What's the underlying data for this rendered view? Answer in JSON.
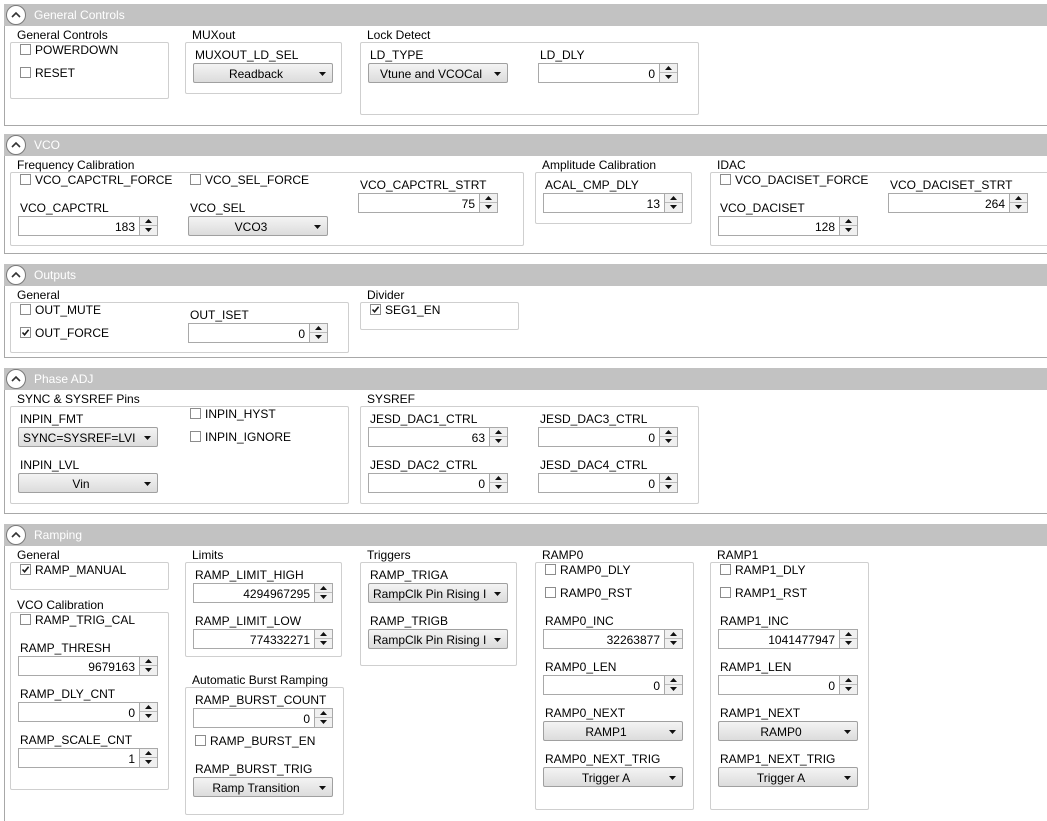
{
  "colors": {
    "header_bg": "#c2c2c2",
    "header_text": "#ffffff",
    "group_border": "#cfcfcf"
  },
  "icons": {
    "toggle": "chevron-up-icon",
    "dropdown": "chevron-down-icon",
    "check": "checkmark-icon"
  },
  "general_controls": {
    "title": "General Controls",
    "group_general": "General Controls",
    "powerdown": {
      "label": "POWERDOWN",
      "checked": false
    },
    "reset": {
      "label": "RESET",
      "checked": false
    },
    "group_muxout": "MUXout",
    "muxout_ld_sel": {
      "label": "MUXOUT_LD_SEL",
      "value": "Readback"
    },
    "group_lock": "Lock Detect",
    "ld_type": {
      "label": "LD_TYPE",
      "value": "Vtune and VCOCal"
    },
    "ld_dly": {
      "label": "LD_DLY",
      "value": "0"
    }
  },
  "vco": {
    "title": "VCO",
    "group_freq": "Frequency Calibration",
    "vco_capctrl_force": {
      "label": "VCO_CAPCTRL_FORCE",
      "checked": false
    },
    "vco_sel_force": {
      "label": "VCO_SEL_FORCE",
      "checked": false
    },
    "vco_capctrl_strt": {
      "label": "VCO_CAPCTRL_STRT",
      "value": "75"
    },
    "vco_capctrl": {
      "label": "VCO_CAPCTRL",
      "value": "183"
    },
    "vco_sel": {
      "label": "VCO_SEL",
      "value": "VCO3"
    },
    "group_ampl": "Amplitude Calibration",
    "acal_cmp_dly": {
      "label": "ACAL_CMP_DLY",
      "value": "13"
    },
    "group_idac": "IDAC",
    "vco_daciset_force": {
      "label": "VCO_DACISET_FORCE",
      "checked": false
    },
    "vco_daciset_strt": {
      "label": "VCO_DACISET_STRT",
      "value": "264"
    },
    "vco_daciset": {
      "label": "VCO_DACISET",
      "value": "128"
    }
  },
  "outputs": {
    "title": "Outputs",
    "group_general": "General",
    "out_mute": {
      "label": "OUT_MUTE",
      "checked": false
    },
    "out_force": {
      "label": "OUT_FORCE",
      "checked": true
    },
    "out_iset": {
      "label": "OUT_ISET",
      "value": "0"
    },
    "group_divider": "Divider",
    "seg1_en": {
      "label": "SEG1_EN",
      "checked": true
    }
  },
  "phase_adj": {
    "title": "Phase ADJ",
    "group_sync": "SYNC & SYSREF Pins",
    "inpin_fmt": {
      "label": "INPIN_FMT",
      "value": "SYNC=SYSREF=LVI"
    },
    "inpin_hyst": {
      "label": "INPIN_HYST",
      "checked": false
    },
    "inpin_ignore": {
      "label": "INPIN_IGNORE",
      "checked": false
    },
    "inpin_lvl": {
      "label": "INPIN_LVL",
      "value": "Vin"
    },
    "group_sysref": "SYSREF",
    "jesd_dac1_ctrl": {
      "label": "JESD_DAC1_CTRL",
      "value": "63"
    },
    "jesd_dac3_ctrl": {
      "label": "JESD_DAC3_CTRL",
      "value": "0"
    },
    "jesd_dac2_ctrl": {
      "label": "JESD_DAC2_CTRL",
      "value": "0"
    },
    "jesd_dac4_ctrl": {
      "label": "JESD_DAC4_CTRL",
      "value": "0"
    }
  },
  "ramping": {
    "title": "Ramping",
    "group_general": "General",
    "ramp_manual": {
      "label": "RAMP_MANUAL",
      "checked": true
    },
    "group_vcocal": "VCO Calibration",
    "ramp_trig_cal": {
      "label": "RAMP_TRIG_CAL",
      "checked": false
    },
    "ramp_thresh": {
      "label": "RAMP_THRESH",
      "value": "9679163"
    },
    "ramp_dly_cnt": {
      "label": "RAMP_DLY_CNT",
      "value": "0"
    },
    "ramp_scale_cnt": {
      "label": "RAMP_SCALE_CNT",
      "value": "1"
    },
    "group_limits": "Limits",
    "ramp_limit_high": {
      "label": "RAMP_LIMIT_HIGH",
      "value": "4294967295"
    },
    "ramp_limit_low": {
      "label": "RAMP_LIMIT_LOW",
      "value": "774332271"
    },
    "group_burst": "Automatic Burst Ramping",
    "ramp_burst_count": {
      "label": "RAMP_BURST_COUNT",
      "value": "0"
    },
    "ramp_burst_en": {
      "label": "RAMP_BURST_EN",
      "checked": false
    },
    "ramp_burst_trig": {
      "label": "RAMP_BURST_TRIG",
      "value": "Ramp Transition"
    },
    "group_triggers": "Triggers",
    "ramp_triga": {
      "label": "RAMP_TRIGA",
      "value": "RampClk Pin Rising I"
    },
    "ramp_trigb": {
      "label": "RAMP_TRIGB",
      "value": "RampClk Pin Rising I"
    },
    "group_ramp0": "RAMP0",
    "ramp0_dly": {
      "label": "RAMP0_DLY",
      "checked": false
    },
    "ramp0_rst": {
      "label": "RAMP0_RST",
      "checked": false
    },
    "ramp0_inc": {
      "label": "RAMP0_INC",
      "value": "32263877"
    },
    "ramp0_len": {
      "label": "RAMP0_LEN",
      "value": "0"
    },
    "ramp0_next": {
      "label": "RAMP0_NEXT",
      "value": "RAMP1"
    },
    "ramp0_next_trig": {
      "label": "RAMP0_NEXT_TRIG",
      "value": "Trigger A"
    },
    "group_ramp1": "RAMP1",
    "ramp1_dly": {
      "label": "RAMP1_DLY",
      "checked": false
    },
    "ramp1_rst": {
      "label": "RAMP1_RST",
      "checked": false
    },
    "ramp1_inc": {
      "label": "RAMP1_INC",
      "value": "1041477947"
    },
    "ramp1_len": {
      "label": "RAMP1_LEN",
      "value": "0"
    },
    "ramp1_next": {
      "label": "RAMP1_NEXT",
      "value": "RAMP0"
    },
    "ramp1_next_trig": {
      "label": "RAMP1_NEXT_TRIG",
      "value": "Trigger A"
    }
  }
}
